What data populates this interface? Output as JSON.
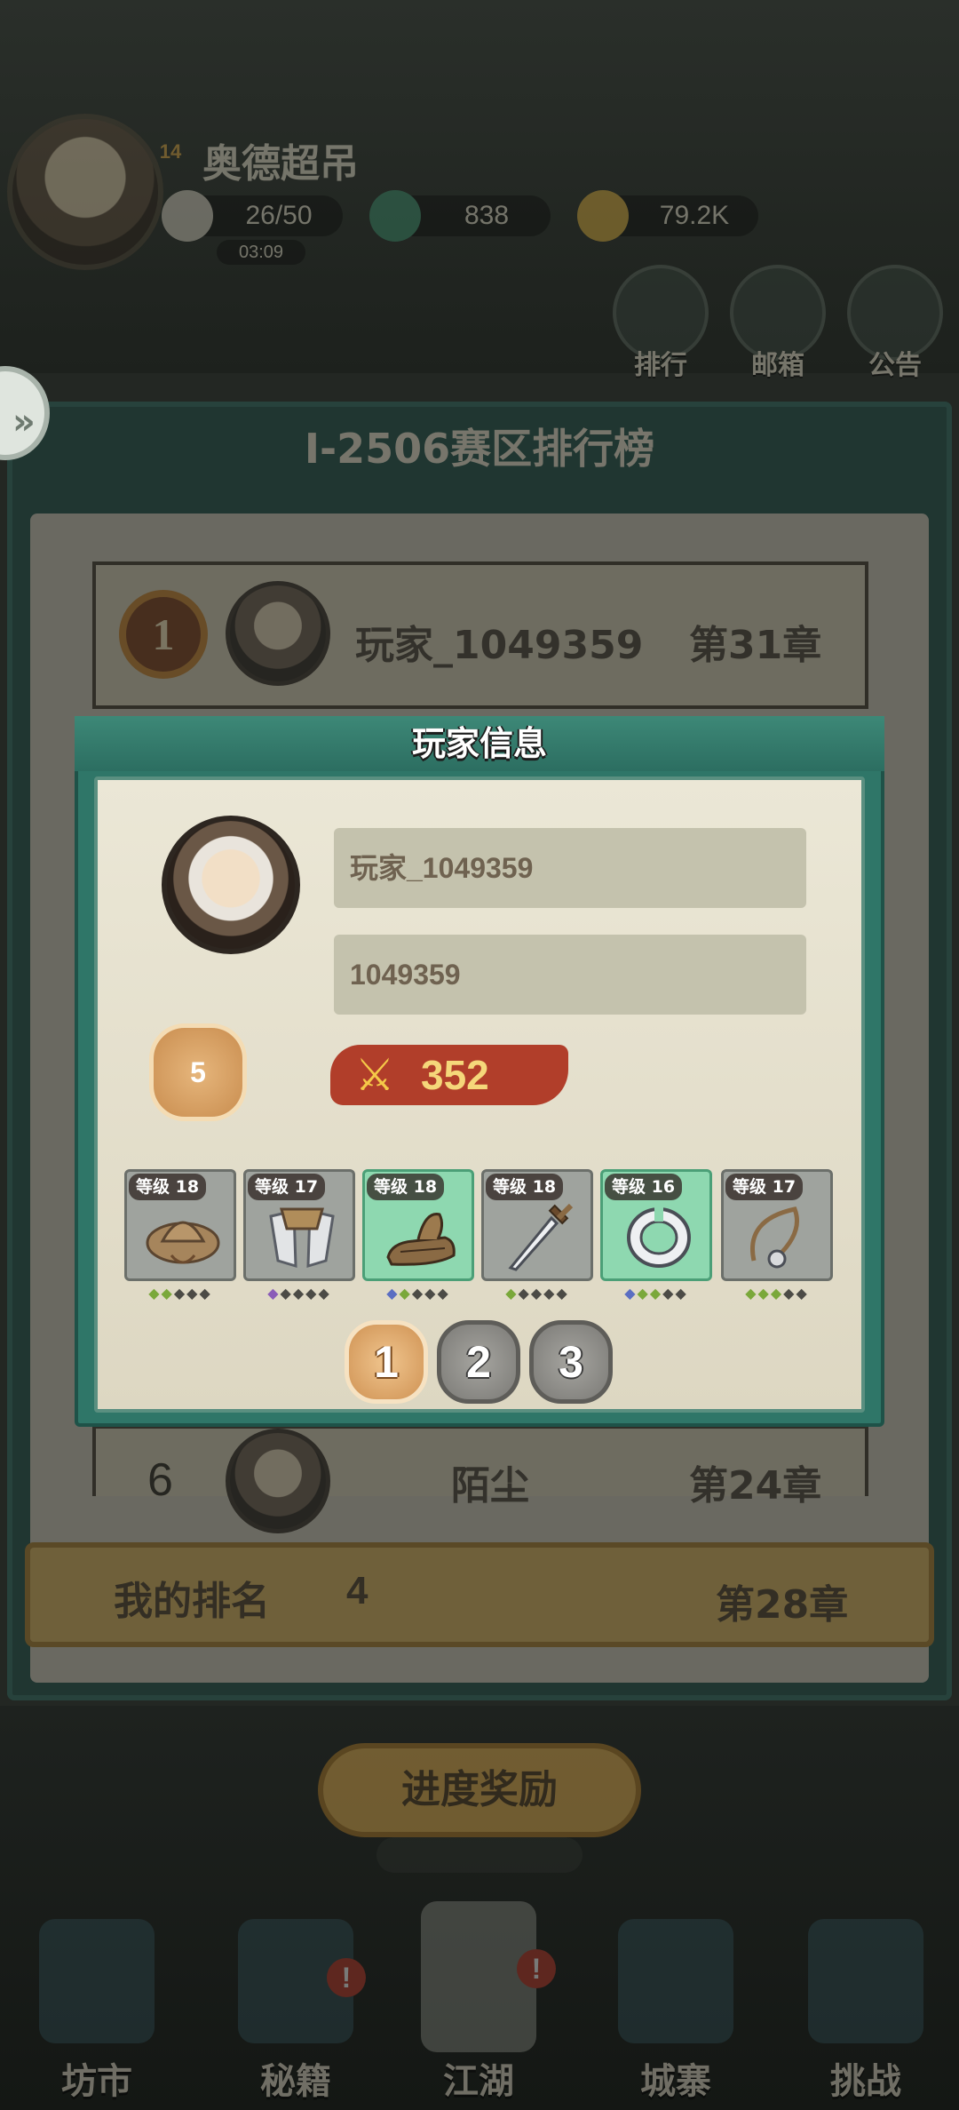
{
  "hud": {
    "level": "14",
    "player_name": "奥德超吊",
    "stamina": "26/50",
    "stamina_timer": "03:09",
    "gems": "838",
    "gold": "79.2K",
    "buttons": {
      "rank": "排行",
      "mail": "邮箱",
      "notice": "公告"
    }
  },
  "leaderboard": {
    "title": "I-2506赛区排行榜",
    "rows": [
      {
        "rank": "1",
        "name": "玩家_1049359",
        "chapter": "第31章"
      },
      {
        "rank": "6",
        "name": "陌尘",
        "chapter": "第24章"
      }
    ],
    "my_rank": {
      "label": "我的排名",
      "value": "4",
      "chapter": "第28章"
    }
  },
  "progress_reward_label": "进度奖励",
  "bottom_nav": [
    {
      "label": "坊市",
      "badge": ""
    },
    {
      "label": "秘籍",
      "badge": "!"
    },
    {
      "label": "江湖",
      "badge": "!"
    },
    {
      "label": "城寨",
      "badge": ""
    },
    {
      "label": "挑战",
      "badge": ""
    }
  ],
  "player_info": {
    "title": "玩家信息",
    "name": "玩家_1049359",
    "id": "1049359",
    "level": "5",
    "power": "352",
    "equipment": [
      {
        "level_label": "等级 18",
        "item_icon": "straw-hat",
        "rarity": "gray",
        "pips": [
          "g",
          "g",
          "d",
          "d",
          "d"
        ]
      },
      {
        "level_label": "等级 17",
        "item_icon": "shoulder-armor",
        "rarity": "gray",
        "pips": [
          "p",
          "d",
          "d",
          "d",
          "d"
        ]
      },
      {
        "level_label": "等级 18",
        "item_icon": "straw-sandal",
        "rarity": "green",
        "pips": [
          "b",
          "g",
          "d",
          "d",
          "d"
        ]
      },
      {
        "level_label": "等级 18",
        "item_icon": "sword",
        "rarity": "gray",
        "pips": [
          "g",
          "d",
          "d",
          "d",
          "d"
        ]
      },
      {
        "level_label": "等级 16",
        "item_icon": "silver-bracelet",
        "rarity": "green",
        "pips": [
          "b",
          "g",
          "g",
          "d",
          "d"
        ]
      },
      {
        "level_label": "等级 17",
        "item_icon": "rope-necklace",
        "rarity": "gray",
        "pips": [
          "g",
          "g",
          "g",
          "d",
          "d"
        ]
      }
    ],
    "pages": [
      "1",
      "2",
      "3"
    ],
    "active_page": "1"
  },
  "colors": {
    "modal_teal": "#2f7668",
    "power_red": "#b13e2a",
    "power_gold": "#f5d77a",
    "active_page": "#cf9253"
  }
}
